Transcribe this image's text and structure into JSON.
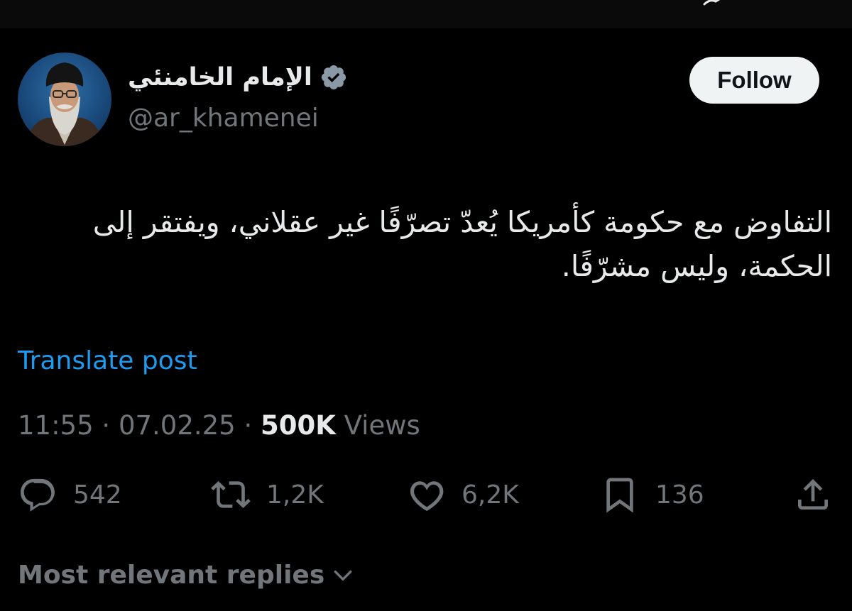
{
  "author": {
    "display_name": "الإمام الخامنئي",
    "handle": "@ar_khamenei",
    "verified_icon": "verified-badge-icon"
  },
  "header": {
    "follow_label": "Follow"
  },
  "post": {
    "text": "التفاوض مع حكومة كأمريكا يُعدّ تصرّفًا غير عقلاني، ويفتقر إلى الحكمة، وليس مشرّفًا.",
    "translate_label": "Translate post",
    "time": "11:55",
    "separator": "·",
    "date": "07.02.25",
    "views_count": "500K",
    "views_label": "Views"
  },
  "actions": {
    "replies": "542",
    "reposts": "1,2K",
    "likes": "6,2K",
    "bookmarks": "136"
  },
  "replies_sort": {
    "label": "Most relevant replies"
  },
  "colors": {
    "background": "#000000",
    "text_primary": "#e7e9ea",
    "text_secondary": "#71767b",
    "link": "#1d9bf0",
    "follow_bg": "#eff3f4"
  }
}
